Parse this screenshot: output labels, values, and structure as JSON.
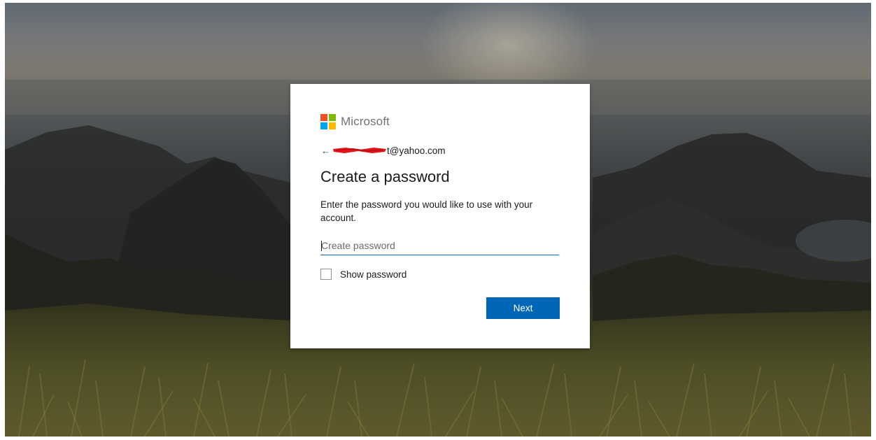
{
  "brand": {
    "name": "Microsoft",
    "logo_colors": [
      "#f25022",
      "#7fba00",
      "#00a4ef",
      "#ffb900"
    ]
  },
  "identity": {
    "back_icon": "←",
    "email_visible_part": "t@yahoo.com"
  },
  "form": {
    "title": "Create a password",
    "description": "Enter the password you would like to use with your account.",
    "password": {
      "value": "",
      "placeholder": "Create password"
    },
    "show_password_label": "Show password",
    "show_password_checked": false
  },
  "actions": {
    "next_label": "Next"
  },
  "colors": {
    "accent": "#0067b8",
    "redaction": "#e8141b"
  }
}
